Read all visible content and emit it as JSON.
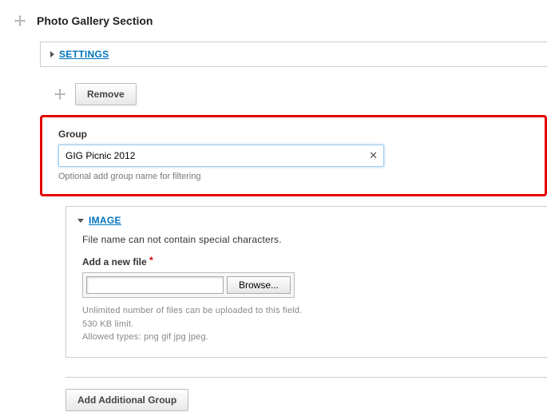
{
  "section": {
    "title": "Photo Gallery Section",
    "settings_label": "SETTINGS"
  },
  "group": {
    "remove_label": "Remove",
    "field_label": "Group",
    "value": "GIG Picnic 2012",
    "hint": "Optional add group name for filtering",
    "clear_glyph": "✕"
  },
  "image_panel": {
    "header_label": "IMAGE",
    "warning": "File name can not contain special characters.",
    "add_file_label": "Add a new file",
    "browse_label": "Browse...",
    "hint1": "Unlimited number of files can be uploaded to this field.",
    "hint2": "530 KB limit.",
    "hint3": "Allowed types: png gif jpg jpeg."
  },
  "bottom": {
    "add_group_label": "Add Additional Group"
  }
}
